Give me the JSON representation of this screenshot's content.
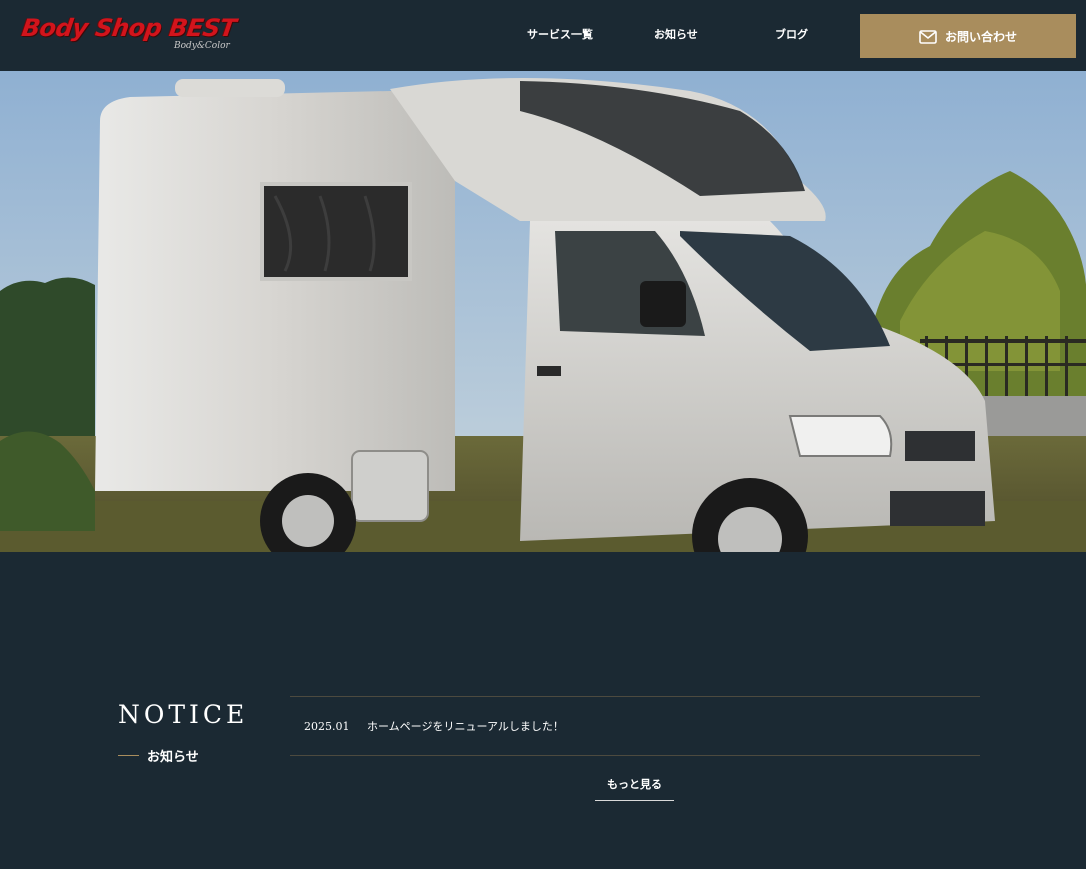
{
  "header": {
    "logo_text": "Body Shop BEST",
    "logo_sub": "Body&Color",
    "nav": [
      "サービス一覧",
      "お知らせ",
      "ブログ"
    ],
    "contact_label": "お問い合わせ",
    "contact_icon": "mail-icon"
  },
  "hero": {
    "image_subject": "camper-van"
  },
  "notice": {
    "title": "NOTICE",
    "subtitle": "お知らせ",
    "items": [
      {
        "date": "2025.01",
        "text": "ホームページをリニューアルしました！"
      }
    ],
    "more_label": "もっと見る"
  },
  "colors": {
    "background": "#1b2933",
    "accent": "#a98d5d",
    "logo_red": "#d2141c"
  }
}
